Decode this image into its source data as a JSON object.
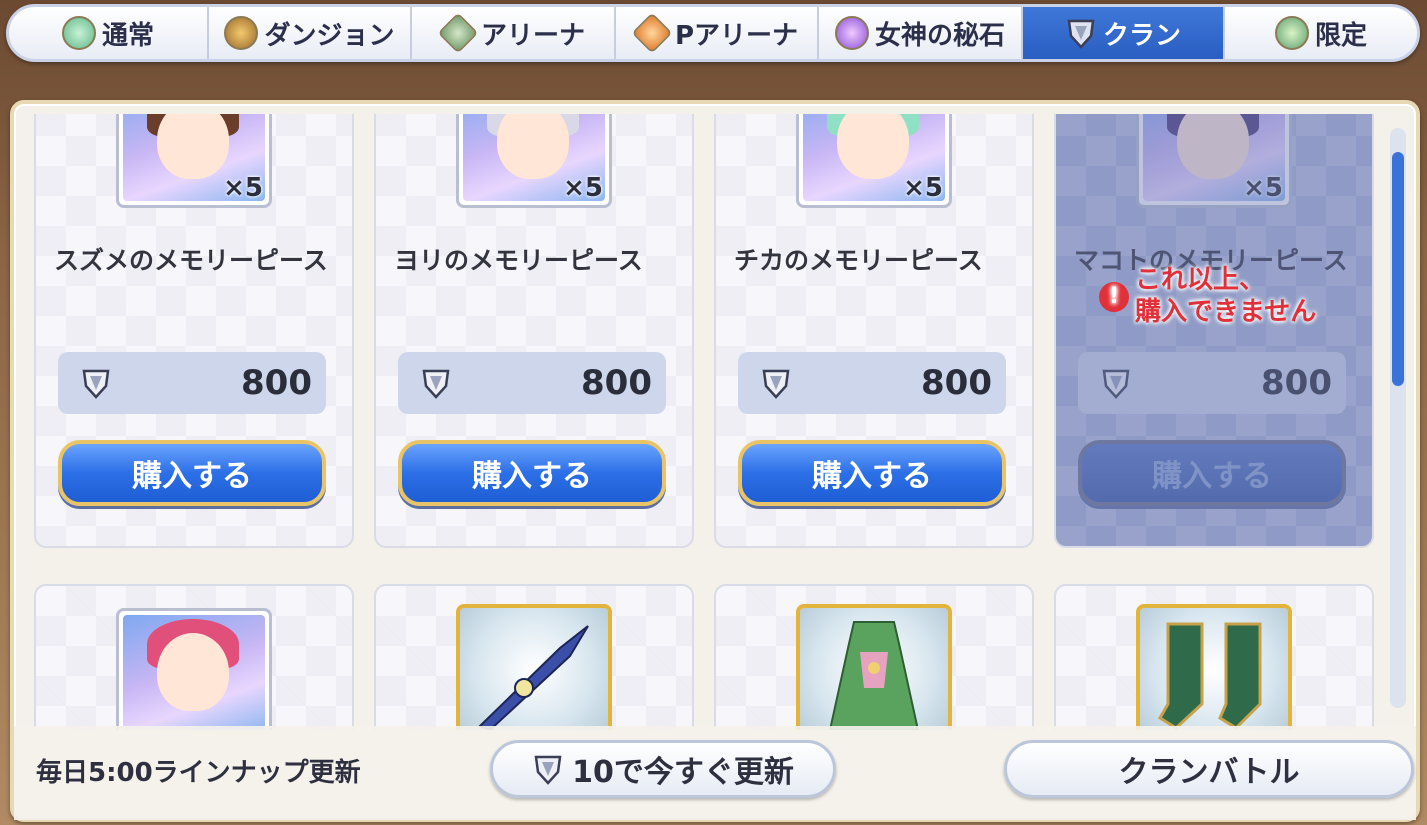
{
  "tabs": [
    {
      "label": "通常",
      "icon": "orb-icon",
      "active": false
    },
    {
      "label": "ダンジョン",
      "icon": "dungeon-coin-icon",
      "active": false
    },
    {
      "label": "アリーナ",
      "icon": "arena-coin-icon",
      "active": false
    },
    {
      "label": "Pアリーナ",
      "icon": "p-arena-coin-icon",
      "active": false
    },
    {
      "label": "女神の秘石",
      "icon": "goddess-stone-icon",
      "active": false
    },
    {
      "label": "クラン",
      "icon": "clan-gem-icon",
      "active": true
    },
    {
      "label": "限定",
      "icon": "limited-orb-icon",
      "active": false
    }
  ],
  "items": [
    {
      "name": "スズメのメモリーピース",
      "quantity": "×5",
      "price": "800",
      "buy_label": "購入する",
      "disabled": false
    },
    {
      "name": "ヨリのメモリーピース",
      "quantity": "×5",
      "price": "800",
      "buy_label": "購入する",
      "disabled": false
    },
    {
      "name": "チカのメモリーピース",
      "quantity": "×5",
      "price": "800",
      "buy_label": "購入する",
      "disabled": false
    },
    {
      "name": "マコトのメモリーピース",
      "quantity": "×5",
      "price": "800",
      "buy_label": "購入する",
      "disabled": true
    }
  ],
  "purchase_warning": {
    "line1": "これ以上、",
    "line2": "購入できません"
  },
  "bottom": {
    "update_schedule": "毎日5:00ラインナップ更新",
    "refresh_button": "10で今すぐ更新",
    "clan_battle_button": "クランバトル"
  },
  "colors": {
    "active_tab": "#2a5ec2",
    "buy_button": "#2c6fe6",
    "warning": "#e0303a",
    "frame_gold": "#e2b43c"
  }
}
